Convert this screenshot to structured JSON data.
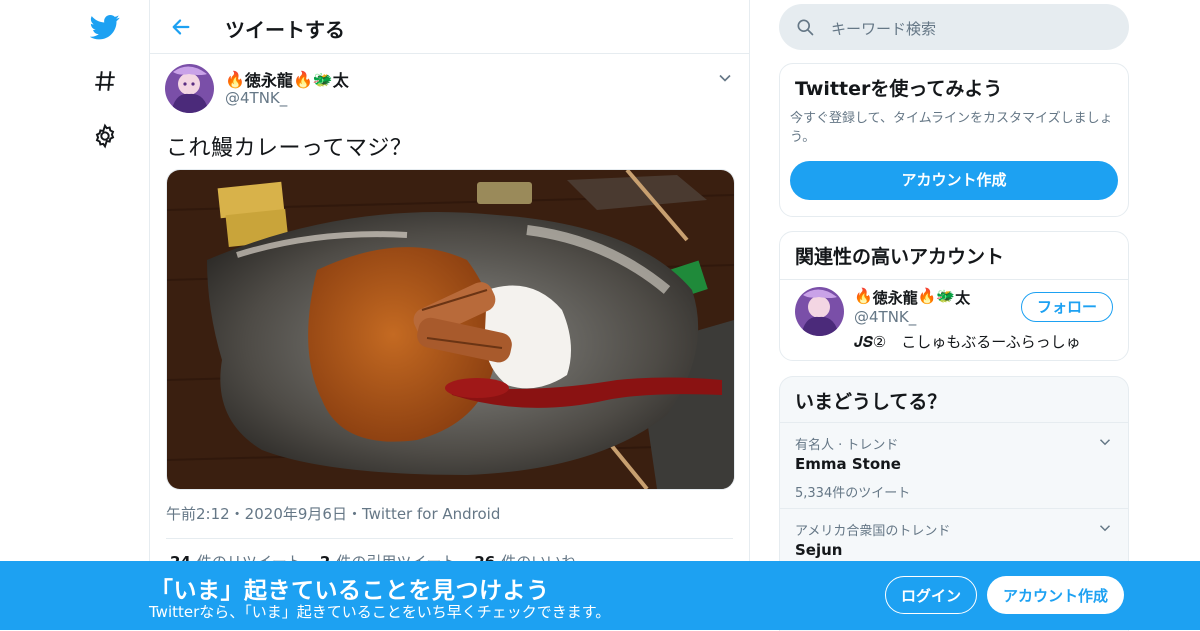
{
  "header": {
    "title": "ツイートする"
  },
  "tweet": {
    "display_name": "徳永龍",
    "name_suffix": "太",
    "handle": "@4TNK_",
    "text": "これ鰻カレーってマジ？",
    "photo_alt": "鰻カレー",
    "meta": "午前2:12・2020年9月6日・Twitter for Android",
    "stats": [
      {
        "count": "24",
        "label": "件のリツイート"
      },
      {
        "count": "2",
        "label": "件の引用ツイート"
      },
      {
        "count": "26",
        "label": "件のいいね"
      }
    ]
  },
  "search": {
    "placeholder": "キーワード検索"
  },
  "signup_card": {
    "title": "Twitterを使ってみよう",
    "body": "今すぐ登録して、タイムラインをカスタマイズしましょう。",
    "button": "アカウント作成"
  },
  "related": {
    "title": "関連性の高いアカウント",
    "display_name": "徳永龍",
    "name_suffix": "太",
    "handle": "@4TNK_",
    "bio": "𝑱𝑺②　こしゅもぶるーふらっしゅ",
    "follow_label": "フォロー"
  },
  "trends": {
    "title": "いまどうしてる？",
    "items": [
      {
        "meta": "有名人 · トレンド",
        "name": "Emma Stone",
        "count": "5,334件のツイート"
      },
      {
        "meta": "アメリカ合衆国のトレンド",
        "name": "Sejun",
        "count": ""
      }
    ]
  },
  "bottom_bar": {
    "title": "「いま」起きていることを見つけよう",
    "subtitle": "Twitterなら、「いま」起きていることをいち早くチェックできます。",
    "login": "ログイン",
    "signup": "アカウント作成"
  },
  "colors": {
    "accent": "#1da1f2",
    "text": "#14171a",
    "muted": "#657786",
    "border": "#e6ecf0"
  },
  "icons": [
    "twitter-bird-icon",
    "hashtag-icon",
    "gear-icon",
    "back-arrow-icon",
    "chevron-down-icon",
    "search-icon",
    "fire-emoji-icon",
    "dragon-emoji-icon"
  ]
}
